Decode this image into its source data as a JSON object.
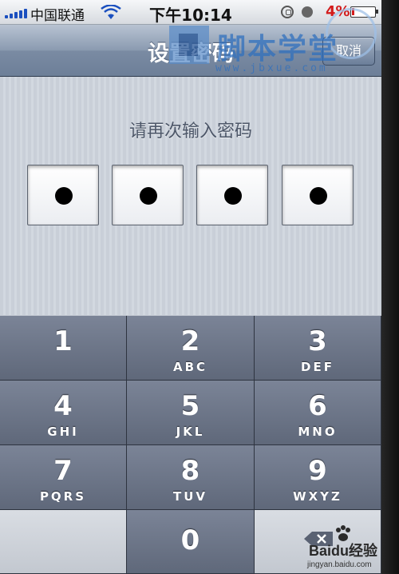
{
  "status_bar": {
    "carrier": "中国联通",
    "time": "下午10:14",
    "battery_percent": "4%",
    "battery_color": "#d31c1c",
    "icons": [
      "signal-bars-icon",
      "wifi-icon",
      "rotation-lock-icon",
      "alarm-icon",
      "battery-icon"
    ]
  },
  "nav": {
    "title": "设置密码",
    "cancel_label": "取消"
  },
  "passcode": {
    "prompt": "请再次输入密码",
    "digits_entered": 4,
    "digits_total": 4
  },
  "keypad": {
    "keys": [
      {
        "digit": "1",
        "letters": ""
      },
      {
        "digit": "2",
        "letters": "ABC"
      },
      {
        "digit": "3",
        "letters": "DEF"
      },
      {
        "digit": "4",
        "letters": "GHI"
      },
      {
        "digit": "5",
        "letters": "JKL"
      },
      {
        "digit": "6",
        "letters": "MNO"
      },
      {
        "digit": "7",
        "letters": "PQRS"
      },
      {
        "digit": "8",
        "letters": "TUV"
      },
      {
        "digit": "9",
        "letters": "WXYZ"
      },
      {
        "digit": "0",
        "letters": ""
      }
    ],
    "delete_icon": "backspace-icon"
  },
  "watermarks": {
    "site_text": "脚本学堂",
    "site_url": "www.jbxue.com",
    "baidu_text": "Baidu经验",
    "baidu_url": "jingyan.baidu.com"
  }
}
